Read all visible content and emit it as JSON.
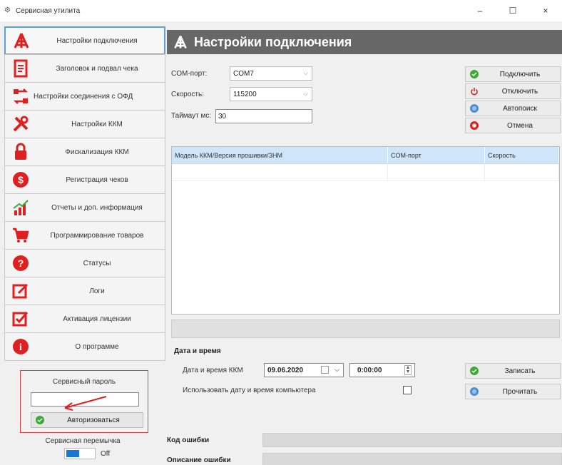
{
  "window": {
    "title": "Сервисная утилита",
    "minimize": "–",
    "maximize": "☐",
    "close": "×"
  },
  "sidebar": {
    "items": [
      {
        "label": "Настройки подключения",
        "icon": "tower-icon",
        "active": true
      },
      {
        "label": "Заголовок и подвал чека",
        "icon": "document-icon"
      },
      {
        "label": "Настройки соединения с ОФД",
        "icon": "network-icon"
      },
      {
        "label": "Настройки ККМ",
        "icon": "tools-icon"
      },
      {
        "label": "Фискализация ККМ",
        "icon": "lock-icon"
      },
      {
        "label": "Регистрация чеков",
        "icon": "dollar-icon"
      },
      {
        "label": "Отчеты и доп. информация",
        "icon": "chart-icon"
      },
      {
        "label": "Программирование товаров",
        "icon": "cart-icon"
      },
      {
        "label": "Статусы",
        "icon": "question-icon"
      },
      {
        "label": "Логи",
        "icon": "edit-icon"
      },
      {
        "label": "Активация лицензии",
        "icon": "checkbox-icon"
      },
      {
        "label": "О программе",
        "icon": "info-icon"
      }
    ],
    "service_password_label": "Сервисный пароль",
    "service_password_value": "",
    "authorize_label": "Авторизоваться",
    "service_switch_label": "Сервисная перемычка",
    "service_switch_state": "Off"
  },
  "header": {
    "title": "Настройки подключения"
  },
  "connection": {
    "com_port_label": "COM-порт:",
    "com_port_value": "COM7",
    "speed_label": "Скорость:",
    "speed_value": "115200",
    "timeout_label": "Таймаут мс:",
    "timeout_value": "30"
  },
  "actions": {
    "connect": "Подключить",
    "disconnect": "Отключить",
    "autosearch": "Автопоиск",
    "cancel": "Отмена"
  },
  "table": {
    "columns": [
      "Модель ККМ/Версия прошивки/ЗНМ",
      "COM-порт",
      "Скорость"
    ],
    "rows": []
  },
  "datetime": {
    "group_title": "Дата и время",
    "kkm_label": "Дата и время ККМ",
    "date_value": "09.06.2020",
    "time_value": "0:00:00",
    "use_pc_time_label": "Использовать дату и время компьютера",
    "use_pc_time_checked": false,
    "write_label": "Записать",
    "read_label": "Прочитать"
  },
  "errors": {
    "code_label": "Код ошибки",
    "code_value": "",
    "description_label": "Описание ошибки",
    "description_value": ""
  },
  "colors": {
    "header_bg": "#676767",
    "active_border": "#5aa0dc",
    "red_icon": "#e02020",
    "green_icon": "#3aaa35",
    "blue_icon": "#4a8fd8",
    "table_header_bg": "#cfe6fa"
  }
}
